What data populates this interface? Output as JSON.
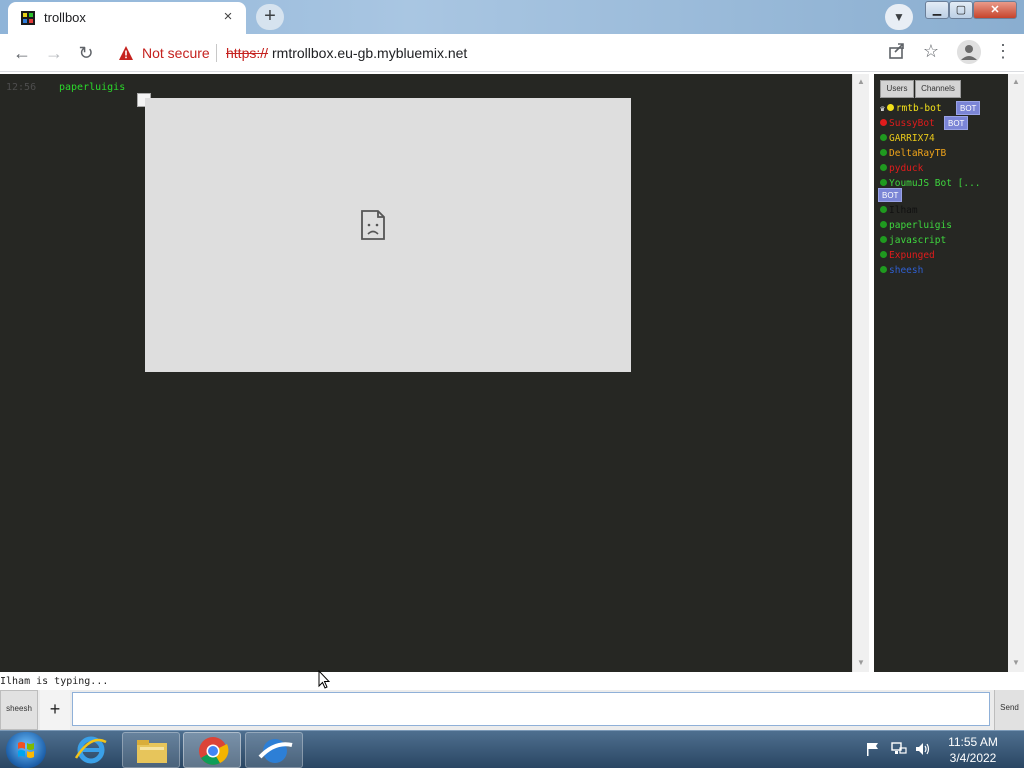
{
  "browser": {
    "tab_title": "trollbox",
    "tab_close": "×",
    "new_tab": "+",
    "security_label": "Not secure",
    "url_scheme": "https://",
    "url_host": "rmtrollbox.eu-gb.mybluemix.net"
  },
  "chat": {
    "message": {
      "time": "12:56",
      "user": "paperluigis"
    }
  },
  "sidebar": {
    "tabs": [
      "Users",
      "Channels"
    ],
    "bot_badge": "BOT",
    "users": [
      {
        "name": "rmtb-bot",
        "color": "#f2e01a",
        "dot": "#f2e01a"
      },
      {
        "name": "SussyBot",
        "color": "#e01c1c",
        "dot": "#e01c1c"
      },
      {
        "name": "GARRIX74",
        "color": "#e8c81a",
        "dot": "#1f9a1f"
      },
      {
        "name": "DeltaRayTB",
        "color": "#f0a41a",
        "dot": "#1f9a1f"
      },
      {
        "name": "pyduck",
        "color": "#e01c1c",
        "dot": "#1f9a1f"
      },
      {
        "name": "YoumuJS Bot [...",
        "color": "#3ed63e",
        "dot": "#1f9a1f"
      },
      {
        "name": "Ilham",
        "color": "#111111",
        "dot": "#1f9a1f"
      },
      {
        "name": "paperluigis",
        "color": "#3ed63e",
        "dot": "#1f9a1f"
      },
      {
        "name": "javascript",
        "color": "#3ed63e",
        "dot": "#1f9a1f"
      },
      {
        "name": "Expunged",
        "color": "#e01c1c",
        "dot": "#1f9a1f"
      },
      {
        "name": "sheesh",
        "color": "#2f5fd0",
        "dot": "#1f9a1f"
      }
    ]
  },
  "status": {
    "typing": "Ilham  is typing..."
  },
  "input": {
    "nick": "sheesh",
    "plus": "+",
    "value": "",
    "send": "Send"
  },
  "taskbar": {
    "time": "11:55 AM",
    "date": "3/4/2022"
  }
}
